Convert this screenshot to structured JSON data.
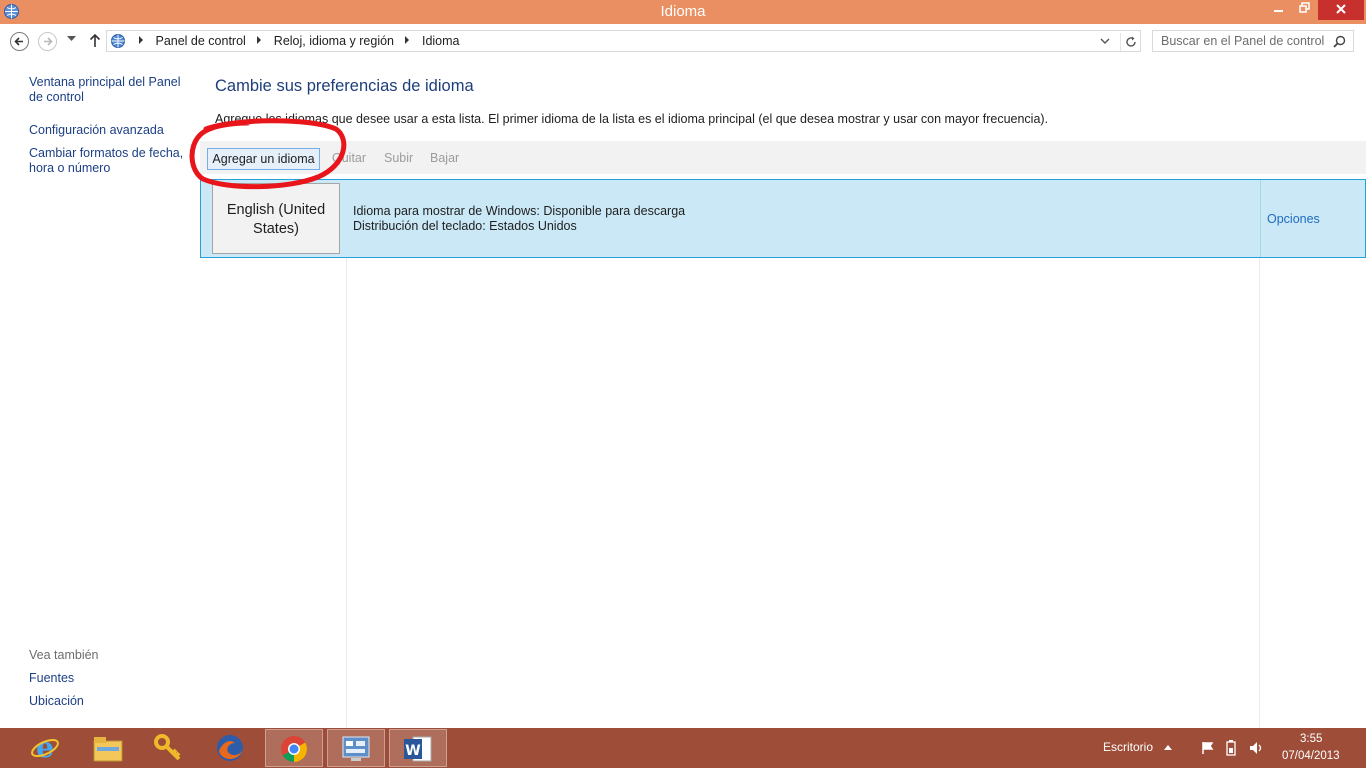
{
  "window": {
    "title": "Idioma",
    "app_icon": "language-globe-icon",
    "controls": {
      "minimize": "minimize-icon",
      "maximize": "restore-icon",
      "close": "close-icon"
    },
    "accent_color": "#e98f62"
  },
  "address_bar": {
    "crumbs": [
      "Panel de control",
      "Reloj, idioma y región",
      "Idioma"
    ],
    "search_placeholder": "Buscar en el Panel de control"
  },
  "left_pane": {
    "links": [
      "Ventana principal del Panel de control",
      "Configuración avanzada",
      "Cambiar formatos de fecha, hora o número"
    ],
    "see_also_title": "Vea también",
    "see_also_links": [
      "Fuentes",
      "Ubicación"
    ]
  },
  "main": {
    "title": "Cambie sus preferencias de idioma",
    "description": "Agregue los idiomas que desee usar a esta lista. El primer idioma de la lista es el idioma principal (el que desea mostrar y usar con mayor frecuencia).",
    "toolbar": {
      "add": "Agregar un idioma",
      "remove": "Quitar",
      "up": "Subir",
      "down": "Bajar"
    },
    "languages": [
      {
        "name": "English (United States)",
        "display_info": "Idioma para mostrar de Windows: Disponible para descarga",
        "keyboard_info": "Distribución del teclado: Estados Unidos",
        "options_label": "Opciones"
      }
    ]
  },
  "taskbar": {
    "apps": [
      "internet-explorer-icon",
      "file-explorer-icon",
      "key-utility-icon",
      "firefox-icon",
      "chrome-icon",
      "control-panel-icon",
      "word-icon"
    ],
    "desktop_label": "Escritorio",
    "time": "3:55",
    "date": "07/04/2013",
    "color": "#9e4e38"
  }
}
